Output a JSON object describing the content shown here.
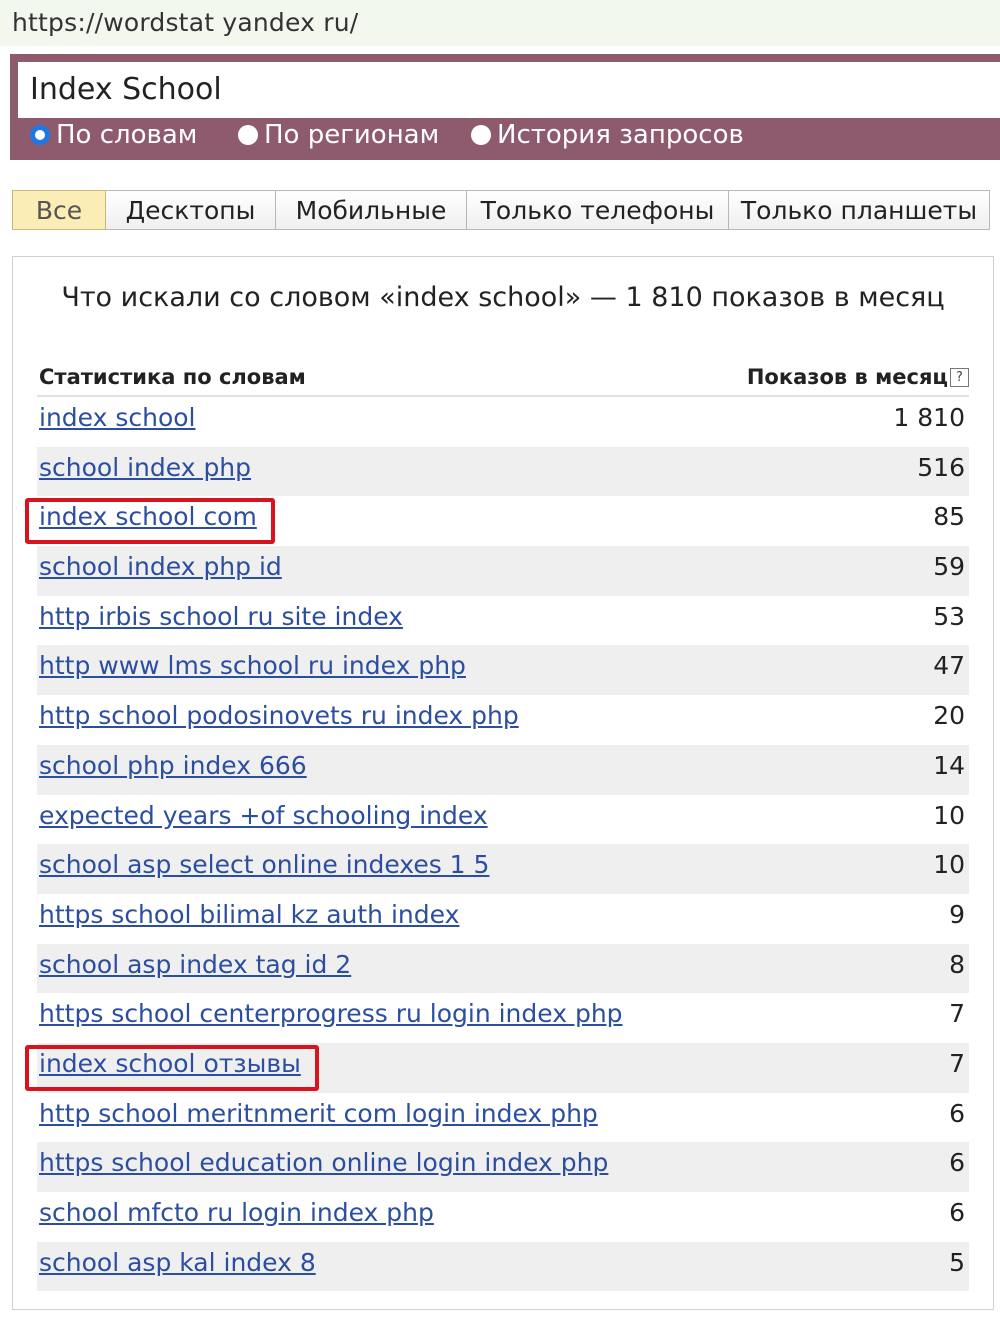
{
  "browser": {
    "url": "https://wordstat yandex ru/"
  },
  "search": {
    "query": "Index School",
    "modes": [
      {
        "label": "По словам",
        "checked": true
      },
      {
        "label": "По регионам",
        "checked": false
      },
      {
        "label": "История запросов",
        "checked": false
      }
    ]
  },
  "device_tabs": [
    "Все",
    "Десктопы",
    "Мобильные",
    "Только телефоны",
    "Только планшеты"
  ],
  "active_tab": "Все",
  "results": {
    "title": "Что искали со словом «index school» — 1 810 показов в месяц",
    "col_phrase": "Статистика по словам",
    "col_count": "Показов в месяц",
    "help_glyph": "?",
    "rows": [
      {
        "phrase": "index school",
        "count": "1 810"
      },
      {
        "phrase": "school index php",
        "count": "516"
      },
      {
        "phrase": "index school com",
        "count": "85"
      },
      {
        "phrase": "school index php id",
        "count": "59"
      },
      {
        "phrase": "http irbis school ru site index",
        "count": "53"
      },
      {
        "phrase": "http www lms school ru index php",
        "count": "47"
      },
      {
        "phrase": "http school podosinovets ru index php",
        "count": "20"
      },
      {
        "phrase": "school php index 666",
        "count": "14"
      },
      {
        "phrase": "expected years +of schooling index",
        "count": "10"
      },
      {
        "phrase": "school asp select online indexes 1 5",
        "count": "10"
      },
      {
        "phrase": "https school bilimal kz auth index",
        "count": "9"
      },
      {
        "phrase": "school asp index tag id 2",
        "count": "8"
      },
      {
        "phrase": "https school centerprogress ru login index php",
        "count": "7"
      },
      {
        "phrase": "index school отзывы",
        "count": "7"
      },
      {
        "phrase": "http school meritnmerit com login index php",
        "count": "6"
      },
      {
        "phrase": "https school education online login index php",
        "count": "6"
      },
      {
        "phrase": "school mfcto ru login index php",
        "count": "6"
      },
      {
        "phrase": "school asp kal index 8",
        "count": "5"
      }
    ],
    "highlighted_rows": [
      2,
      13
    ],
    "highlight_color": "#d7141e",
    "link_color": "#2c4ea1"
  }
}
